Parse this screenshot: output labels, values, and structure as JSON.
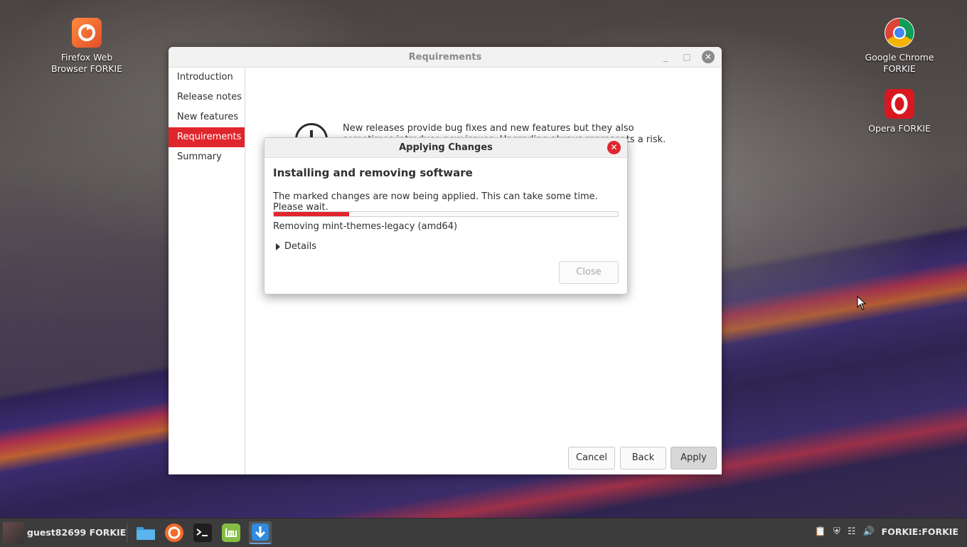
{
  "desktop": {
    "icons": [
      {
        "label": "Firefox Web Browser FORKIE",
        "icon": "firefox-icon"
      },
      {
        "label": "Google Chrome FORKIE",
        "icon": "chrome-icon"
      },
      {
        "label": "Opera FORKIE",
        "icon": "opera-icon"
      }
    ]
  },
  "window": {
    "title": "Requirements",
    "sidebar": {
      "items": [
        {
          "label": "Introduction"
        },
        {
          "label": "Release notes"
        },
        {
          "label": "New features"
        },
        {
          "label": "Requirements",
          "active": true
        },
        {
          "label": "Summary"
        }
      ]
    },
    "content": {
      "info_text": "New releases provide bug fixes and new features but they also sometimes introduce new issues. Upgrading always represents a risk. Your data is safe"
    },
    "buttons": {
      "cancel": "Cancel",
      "back": "Back",
      "apply": "Apply"
    }
  },
  "dialog": {
    "title": "Applying Changes",
    "heading": "Installing and removing software",
    "message": "The marked changes are now being applied. This can take some time. Please wait.",
    "progress_fraction": 0.22,
    "status": "Removing mint-themes-legacy (amd64)",
    "details_label": "Details",
    "close_label": "Close"
  },
  "taskbar": {
    "user": "guest82699 FORKIE",
    "apps": [
      "files-icon",
      "firefox-icon",
      "terminal-icon",
      "mint-icon",
      "update-manager-icon"
    ],
    "tray_label": "FORKIE:FORKIE"
  },
  "colors": {
    "accent": "#e0262d"
  }
}
